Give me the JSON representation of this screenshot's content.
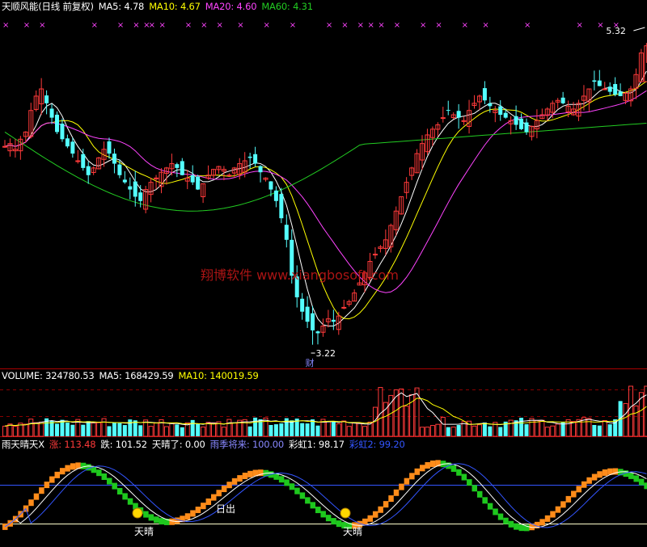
{
  "colors": {
    "up": "#ff3a3a",
    "down": "#54ffff",
    "white": "#ffffff",
    "yellow": "#ffff00",
    "magenta": "#ff44ff",
    "green": "#22cc22",
    "sep": "#aa0000",
    "grid": "#880000",
    "orange": "#ff8c1a",
    "fillgreen": "#1ec81e",
    "blue": "#3355ff",
    "purple": "#8888ff"
  },
  "main": {
    "title": "天顺风能(日线 前复权)",
    "ma5": "MA5: 4.78",
    "ma10": "MA10: 4.67",
    "ma20": "MA20: 4.60",
    "ma60": "MA60: 4.31",
    "high_label": "5.32",
    "low_label": "3.22",
    "cai_label": "财",
    "watermark": "翔博软件 www.xiangbosoft.com",
    "marker_char": "×"
  },
  "volume": {
    "label": "VOLUME: 324780.53",
    "ma5": "MA5: 168429.59",
    "ma10": "MA10: 140019.59"
  },
  "indicator": {
    "name": "雨天晴天X",
    "zhang": "涨: 113.48",
    "die": "跌: 101.52",
    "tianqing": "天晴了: 0.00",
    "yuji": "雨季将来: 100.00",
    "caihong1": "彩虹1: 98.17",
    "caihong2": "彩虹2: 99.20",
    "label_tianqing": "天晴",
    "label_richu": "日出"
  },
  "chart_data": {
    "type": "candlestick",
    "title": "天顺风能(日线 前复权)",
    "price_extremes": {
      "high": 5.32,
      "low": 3.22
    },
    "moving_averages": {
      "MA5": 4.78,
      "MA10": 4.67,
      "MA20": 4.6,
      "MA60": 4.31
    },
    "volume": {
      "last": 324780.53,
      "MA5": 168429.59,
      "MA10": 140019.59
    },
    "indicator": {
      "涨": 113.48,
      "跌": 101.52,
      "天晴了": 0.0,
      "雨季将来": 100.0,
      "彩虹1": 98.17,
      "彩虹2": 99.2
    },
    "close_path": [
      4.6,
      4.62,
      4.58,
      4.65,
      4.7,
      4.85,
      4.95,
      5.0,
      4.9,
      4.8,
      4.7,
      4.65,
      4.6,
      4.55,
      4.5,
      4.45,
      4.4,
      4.45,
      4.52,
      4.58,
      4.55,
      4.48,
      4.4,
      4.35,
      4.3,
      4.25,
      4.22,
      4.3,
      4.35,
      4.38,
      4.42,
      4.45,
      4.48,
      4.45,
      4.4,
      4.38,
      4.35,
      4.3,
      4.34,
      4.4,
      4.44,
      4.46,
      4.44,
      4.4,
      4.45,
      4.48,
      4.5,
      4.52,
      4.48,
      4.42,
      4.38,
      4.3,
      4.22,
      4.1,
      3.95,
      3.7,
      3.55,
      3.45,
      3.38,
      3.32,
      3.3,
      3.35,
      3.4,
      3.38,
      3.42,
      3.48,
      3.52,
      3.58,
      3.65,
      3.72,
      3.8,
      3.85,
      3.9,
      3.95,
      4.05,
      4.15,
      4.25,
      4.35,
      4.45,
      4.55,
      4.62,
      4.68,
      4.72,
      4.75,
      4.8,
      4.85,
      4.82,
      4.8,
      4.78,
      4.85,
      4.9,
      4.95,
      4.92,
      4.88,
      4.85,
      4.82,
      4.8,
      4.78,
      4.75,
      4.72,
      4.7,
      4.74,
      4.78,
      4.82,
      4.86,
      4.9,
      4.92,
      4.9,
      4.88,
      4.86,
      4.9,
      4.95,
      5.0,
      5.05,
      5.02,
      5.0,
      4.98,
      4.96,
      4.95,
      4.97,
      5.0,
      5.1,
      5.25,
      5.32
    ]
  }
}
